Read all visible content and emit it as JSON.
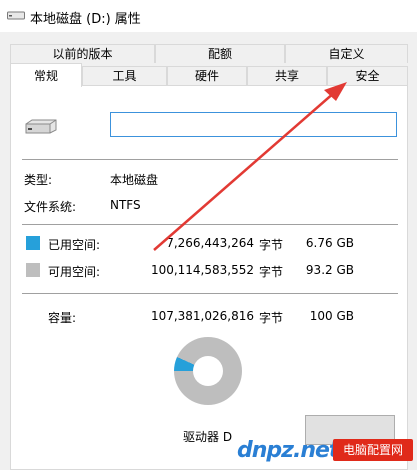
{
  "window": {
    "title": "本地磁盘 (D:) 属性"
  },
  "tabs": {
    "row1": [
      "以前的版本",
      "配额",
      "自定义"
    ],
    "row2": [
      "常规",
      "工具",
      "硬件",
      "共享",
      "安全"
    ],
    "active": "常规"
  },
  "general": {
    "name_value": "",
    "type_label": "类型:",
    "type_value": "本地磁盘",
    "fs_label": "文件系统:",
    "fs_value": "NTFS",
    "used_label": "已用空间:",
    "used_bytes": "7,266,443,264",
    "used_unit": "字节",
    "used_gb": "6.76 GB",
    "free_label": "可用空间:",
    "free_bytes": "100,114,583,552",
    "free_unit": "字节",
    "free_gb": "93.2 GB",
    "capacity_label": "容量:",
    "capacity_bytes": "107,381,026,816",
    "capacity_unit": "字节",
    "capacity_gb": "100 GB",
    "drive_label": "驱动器 D"
  },
  "colors": {
    "used": "#26a0da",
    "free": "#bebebe",
    "arrow": "#e23a34",
    "accent": "#3c92dc"
  },
  "pie": {
    "used_fraction": 0.0677
  },
  "watermark": {
    "text": "dnpz.net",
    "badge": "电脑配置网"
  },
  "icons": {
    "title": "drive-icon",
    "drive": "drive-icon"
  }
}
